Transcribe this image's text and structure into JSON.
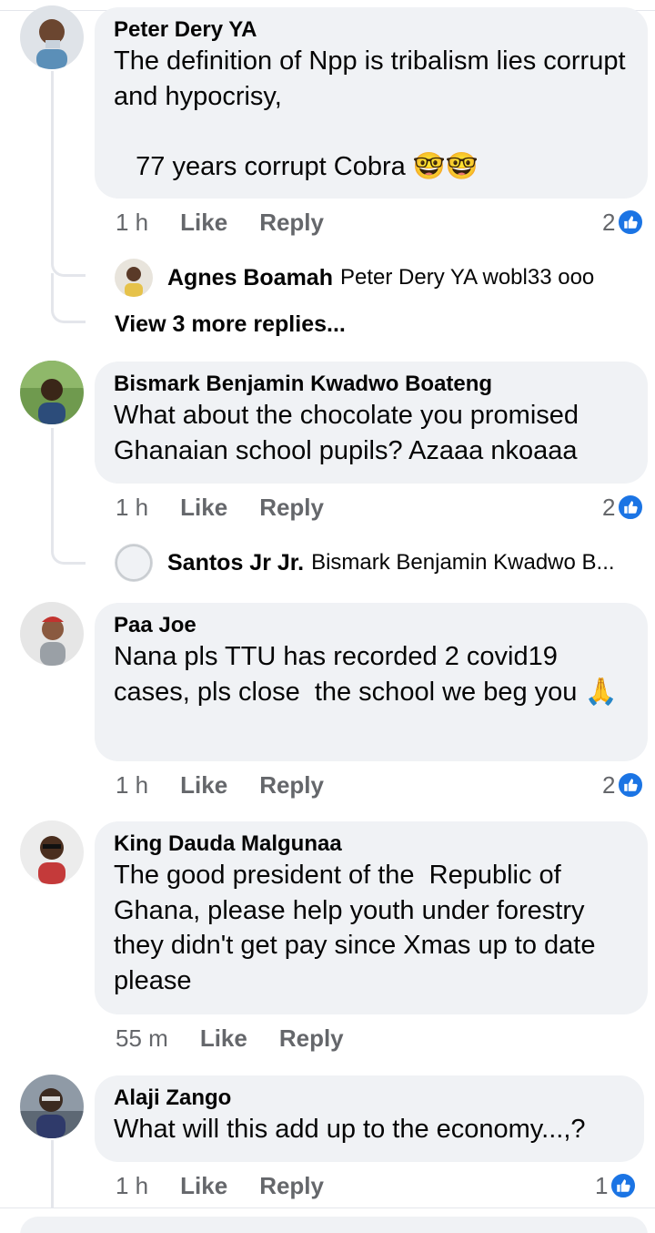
{
  "comments": [
    {
      "author": "Peter Dery YA",
      "text": "The definition of Npp is tribalism lies corrupt and hypocrisy,\n\n   77 years corrupt Cobra 🤓🤓",
      "time": "1 h",
      "like_label": "Like",
      "reply_label": "Reply",
      "reaction_count": "2",
      "reply_preview": {
        "author": "Agnes Boamah",
        "text": "Peter Dery YA wobl33 ooo"
      },
      "view_more": "View 3 more replies..."
    },
    {
      "author": "Bismark Benjamin Kwadwo Boateng",
      "text": "What about the chocolate you promised Ghanaian school pupils? Azaaa nkoaaa",
      "time": "1 h",
      "like_label": "Like",
      "reply_label": "Reply",
      "reaction_count": "2",
      "reply_preview": {
        "author": "Santos Jr Jr.",
        "text": "Bismark Benjamin Kwadwo B..."
      }
    },
    {
      "author": "Paa Joe",
      "text": "Nana pls TTU has recorded 2 covid19 cases, pls close  the school we beg you 🙏",
      "time": "1 h",
      "like_label": "Like",
      "reply_label": "Reply",
      "reaction_count": "2"
    },
    {
      "author": "King Dauda Malgunaa",
      "text": "The good president of the  Republic of Ghana, please help youth under forestry they didn't get pay since Xmas up to date please",
      "time": "55 m",
      "like_label": "Like",
      "reply_label": "Reply"
    },
    {
      "author": "Alaji Zango",
      "text": "What will this add up to the economy...,?",
      "time": "1 h",
      "like_label": "Like",
      "reply_label": "Reply",
      "reaction_count": "1"
    }
  ],
  "icons": {
    "reaction": "like-icon"
  },
  "colors": {
    "accent": "#1b74e4",
    "bubble": "#f0f2f5",
    "muted": "#65676b"
  }
}
